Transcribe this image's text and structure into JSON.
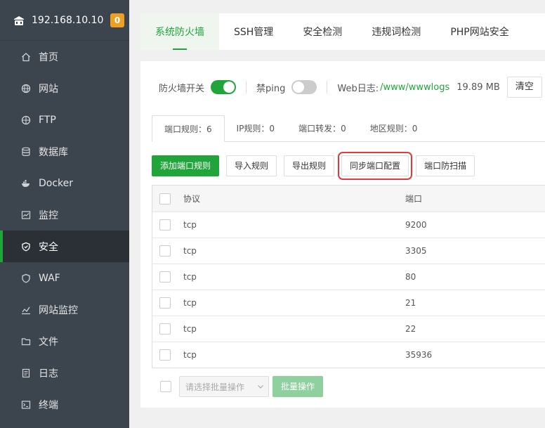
{
  "sidebar": {
    "server_ip": "192.168.10.10",
    "badge": "0",
    "items": [
      {
        "label": "首页",
        "icon": "home-icon"
      },
      {
        "label": "网站",
        "icon": "globe-icon"
      },
      {
        "label": "FTP",
        "icon": "ftp-icon"
      },
      {
        "label": "数据库",
        "icon": "database-icon"
      },
      {
        "label": "Docker",
        "icon": "docker-icon"
      },
      {
        "label": "监控",
        "icon": "monitor-icon"
      },
      {
        "label": "安全",
        "icon": "shield-icon",
        "active": true
      },
      {
        "label": "WAF",
        "icon": "waf-icon"
      },
      {
        "label": "网站监控",
        "icon": "chart-icon"
      },
      {
        "label": "文件",
        "icon": "folder-icon"
      },
      {
        "label": "日志",
        "icon": "log-icon"
      },
      {
        "label": "终端",
        "icon": "terminal-icon"
      }
    ]
  },
  "top_tabs": [
    "系统防火墙",
    "SSH管理",
    "安全检测",
    "违规词检测",
    "PHP网站安全"
  ],
  "firewall": {
    "switch_label": "防火墙开关",
    "switch_on": true,
    "ping_label": "禁ping",
    "ping_on": false,
    "weblog_label": "Web日志:",
    "weblog_path": "/www/wwwlogs",
    "weblog_size": "19.89 MB",
    "clear_label": "清空"
  },
  "sub_tabs": [
    "端口规则：6",
    "IP规则：0",
    "端口转发：0",
    "地区规则：0"
  ],
  "actions": {
    "add": "添加端口规则",
    "import": "导入规则",
    "export": "导出规则",
    "sync": "同步端口配置",
    "scan": "端口防扫描"
  },
  "table": {
    "headers": {
      "protocol": "协议",
      "port": "端口"
    },
    "rows": [
      {
        "protocol": "tcp",
        "port": "9200"
      },
      {
        "protocol": "tcp",
        "port": "3305"
      },
      {
        "protocol": "tcp",
        "port": "80"
      },
      {
        "protocol": "tcp",
        "port": "21"
      },
      {
        "protocol": "tcp",
        "port": "22"
      },
      {
        "protocol": "tcp",
        "port": "35936"
      }
    ]
  },
  "footer": {
    "batch_placeholder": "请选择批量操作",
    "batch_button": "批量操作"
  },
  "colors": {
    "accent": "#20a53a",
    "sidebar_bg": "#3c444d",
    "badge": "#f0a020",
    "highlight_box": "#e03b3b"
  }
}
